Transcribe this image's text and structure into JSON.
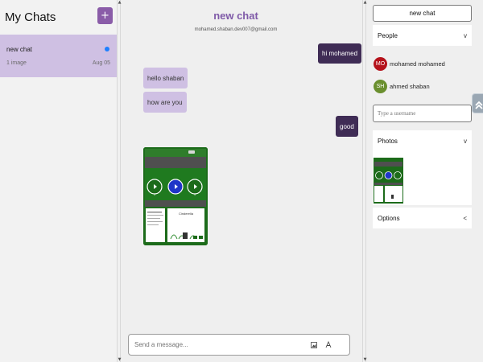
{
  "sidebar": {
    "title": "My Chats",
    "add_icon": "plus-icon",
    "add_label": "+",
    "chats": [
      {
        "name": "new chat",
        "subtitle": "1 image",
        "date": "Aug 05",
        "unread": true
      }
    ]
  },
  "chat": {
    "title": "new chat",
    "email": "mohamed.shaban.dev007@gmail.com",
    "messages": [
      {
        "text": "hi mohamed",
        "direction": "outgoing"
      },
      {
        "text": "hello shaban",
        "direction": "incoming"
      },
      {
        "text": "how are you",
        "direction": "incoming"
      },
      {
        "text": "good",
        "direction": "outgoing"
      },
      {
        "type": "image",
        "direction": "incoming"
      }
    ],
    "input_placeholder": "Send a message...",
    "image_icon": "image-icon",
    "text_format_icon": "text-format-icon",
    "image_preview": {
      "dial_left": "3",
      "dial_right": "4",
      "card_title": "Cinderella"
    }
  },
  "right_panel": {
    "new_chat_label": "new chat",
    "people_label": "People",
    "people": [
      {
        "initials": "MO",
        "name": "mohamed mohamed",
        "color": "#b5121b"
      },
      {
        "initials": "SH",
        "name": "ahmed shaban",
        "color": "#6a8f2e"
      }
    ],
    "username_placeholder": "Type a username",
    "photos_label": "Photos",
    "options_label": "Options",
    "chevron_down": "v",
    "chevron_left": "<"
  },
  "colors": {
    "accent": "#7f5aa8",
    "outgoing_bubble": "#3f2c55",
    "incoming_bubble": "#cfc0e3",
    "selected_chat": "#cfc0e3",
    "unread_dot": "#1e80ff"
  }
}
